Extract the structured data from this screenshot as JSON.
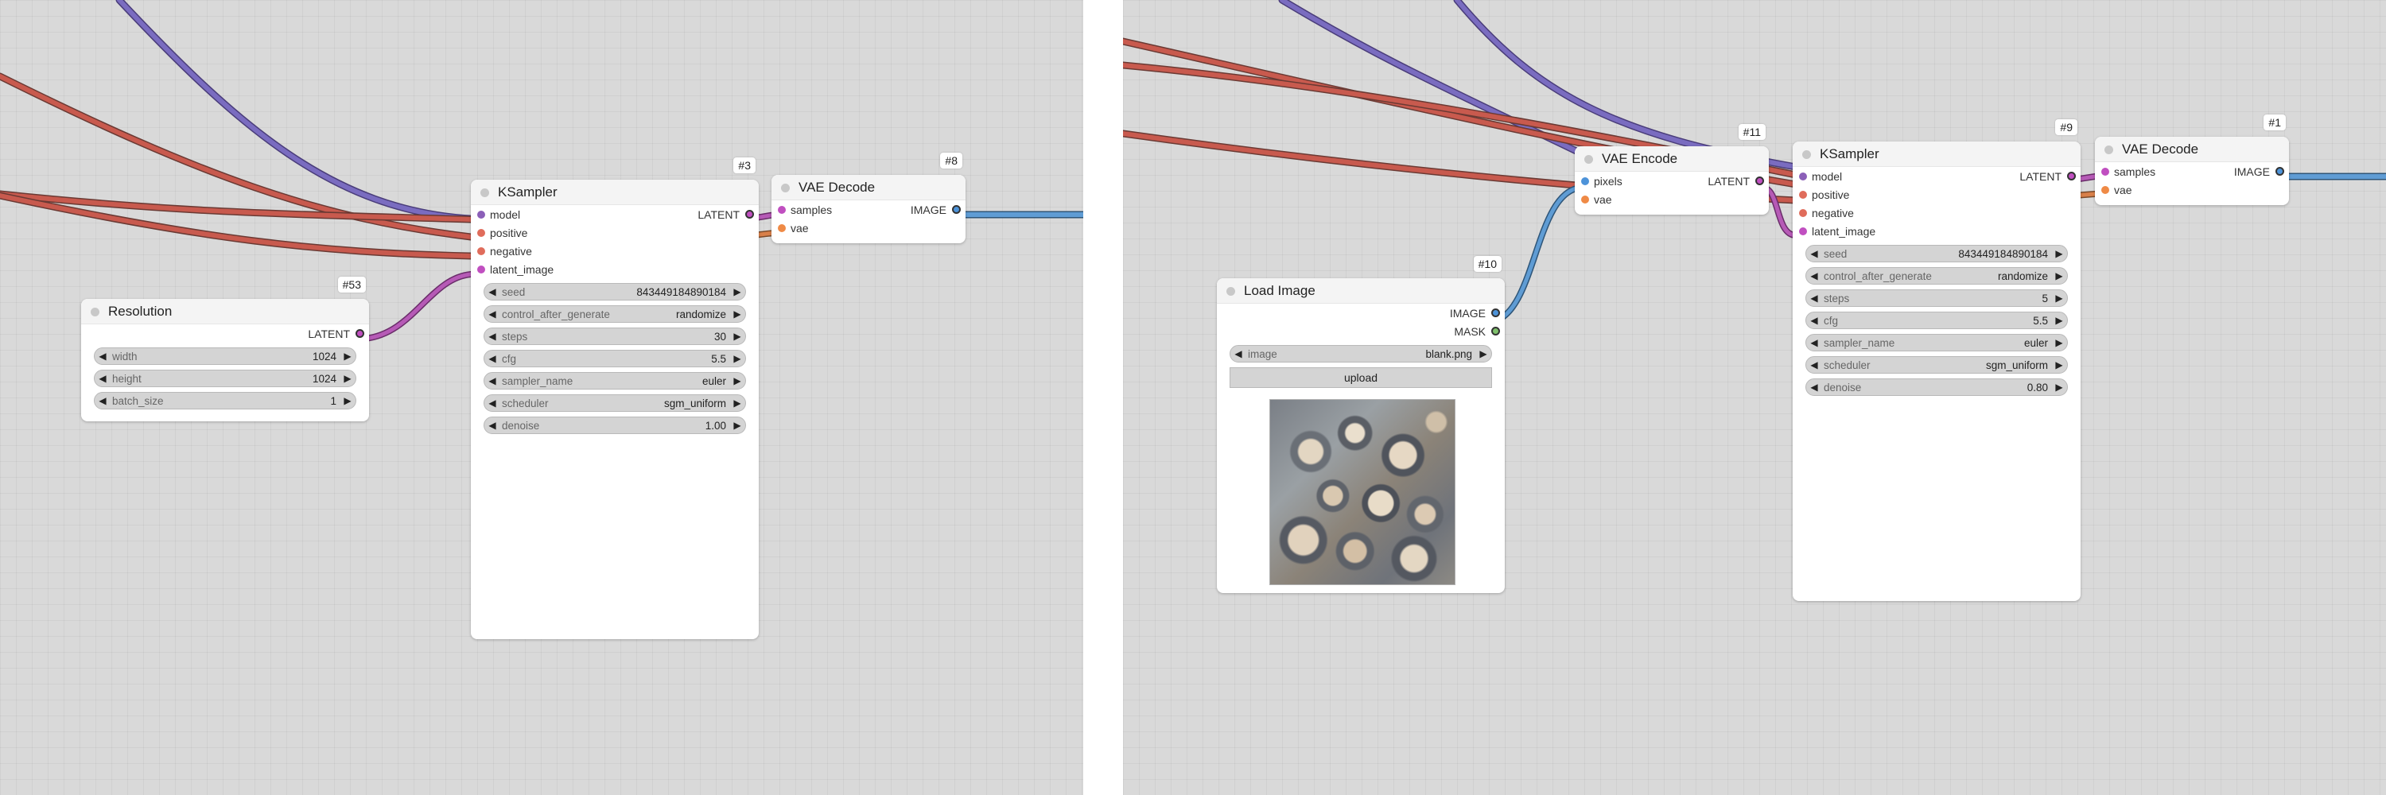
{
  "colors": {
    "model": "#8b5fb8",
    "conditioning": "#e06c5b",
    "latent": "#c04fc0",
    "image": "#4d93d9",
    "vae": "#ef8a46",
    "mask": "#7ec06b"
  },
  "left": {
    "ksampler": {
      "title": "KSampler",
      "id": "#3",
      "inputs": [
        "model",
        "positive",
        "negative",
        "latent_image"
      ],
      "output": "LATENT",
      "widgets": [
        {
          "label": "seed",
          "value": "843449184890184"
        },
        {
          "label": "control_after_generate",
          "value": "randomize"
        },
        {
          "label": "steps",
          "value": "30"
        },
        {
          "label": "cfg",
          "value": "5.5"
        },
        {
          "label": "sampler_name",
          "value": "euler"
        },
        {
          "label": "scheduler",
          "value": "sgm_uniform"
        },
        {
          "label": "denoise",
          "value": "1.00"
        }
      ]
    },
    "vae_decode": {
      "title": "VAE Decode",
      "id": "#8",
      "inputs": [
        "samples",
        "vae"
      ],
      "output": "IMAGE"
    },
    "resolution": {
      "title": "Resolution",
      "id": "#53",
      "output": "LATENT",
      "widgets": [
        {
          "label": "width",
          "value": "1024"
        },
        {
          "label": "height",
          "value": "1024"
        },
        {
          "label": "batch_size",
          "value": "1"
        }
      ]
    }
  },
  "right": {
    "vae_encode": {
      "title": "VAE Encode",
      "id": "#11",
      "inputs": [
        "pixels",
        "vae"
      ],
      "output": "LATENT"
    },
    "ksampler": {
      "title": "KSampler",
      "id": "#9",
      "inputs": [
        "model",
        "positive",
        "negative",
        "latent_image"
      ],
      "output": "LATENT",
      "widgets": [
        {
          "label": "seed",
          "value": "843449184890184"
        },
        {
          "label": "control_after_generate",
          "value": "randomize"
        },
        {
          "label": "steps",
          "value": "5"
        },
        {
          "label": "cfg",
          "value": "5.5"
        },
        {
          "label": "sampler_name",
          "value": "euler"
        },
        {
          "label": "scheduler",
          "value": "sgm_uniform"
        },
        {
          "label": "denoise",
          "value": "0.80"
        }
      ]
    },
    "vae_decode": {
      "title": "VAE Decode",
      "id": "#1",
      "inputs": [
        "samples",
        "vae"
      ],
      "output": "IMAGE"
    },
    "load_image": {
      "title": "Load Image",
      "id": "#10",
      "outputs": [
        "IMAGE",
        "MASK"
      ],
      "image_widget": {
        "label": "image",
        "value": "blank.png"
      },
      "upload_label": "upload"
    }
  }
}
